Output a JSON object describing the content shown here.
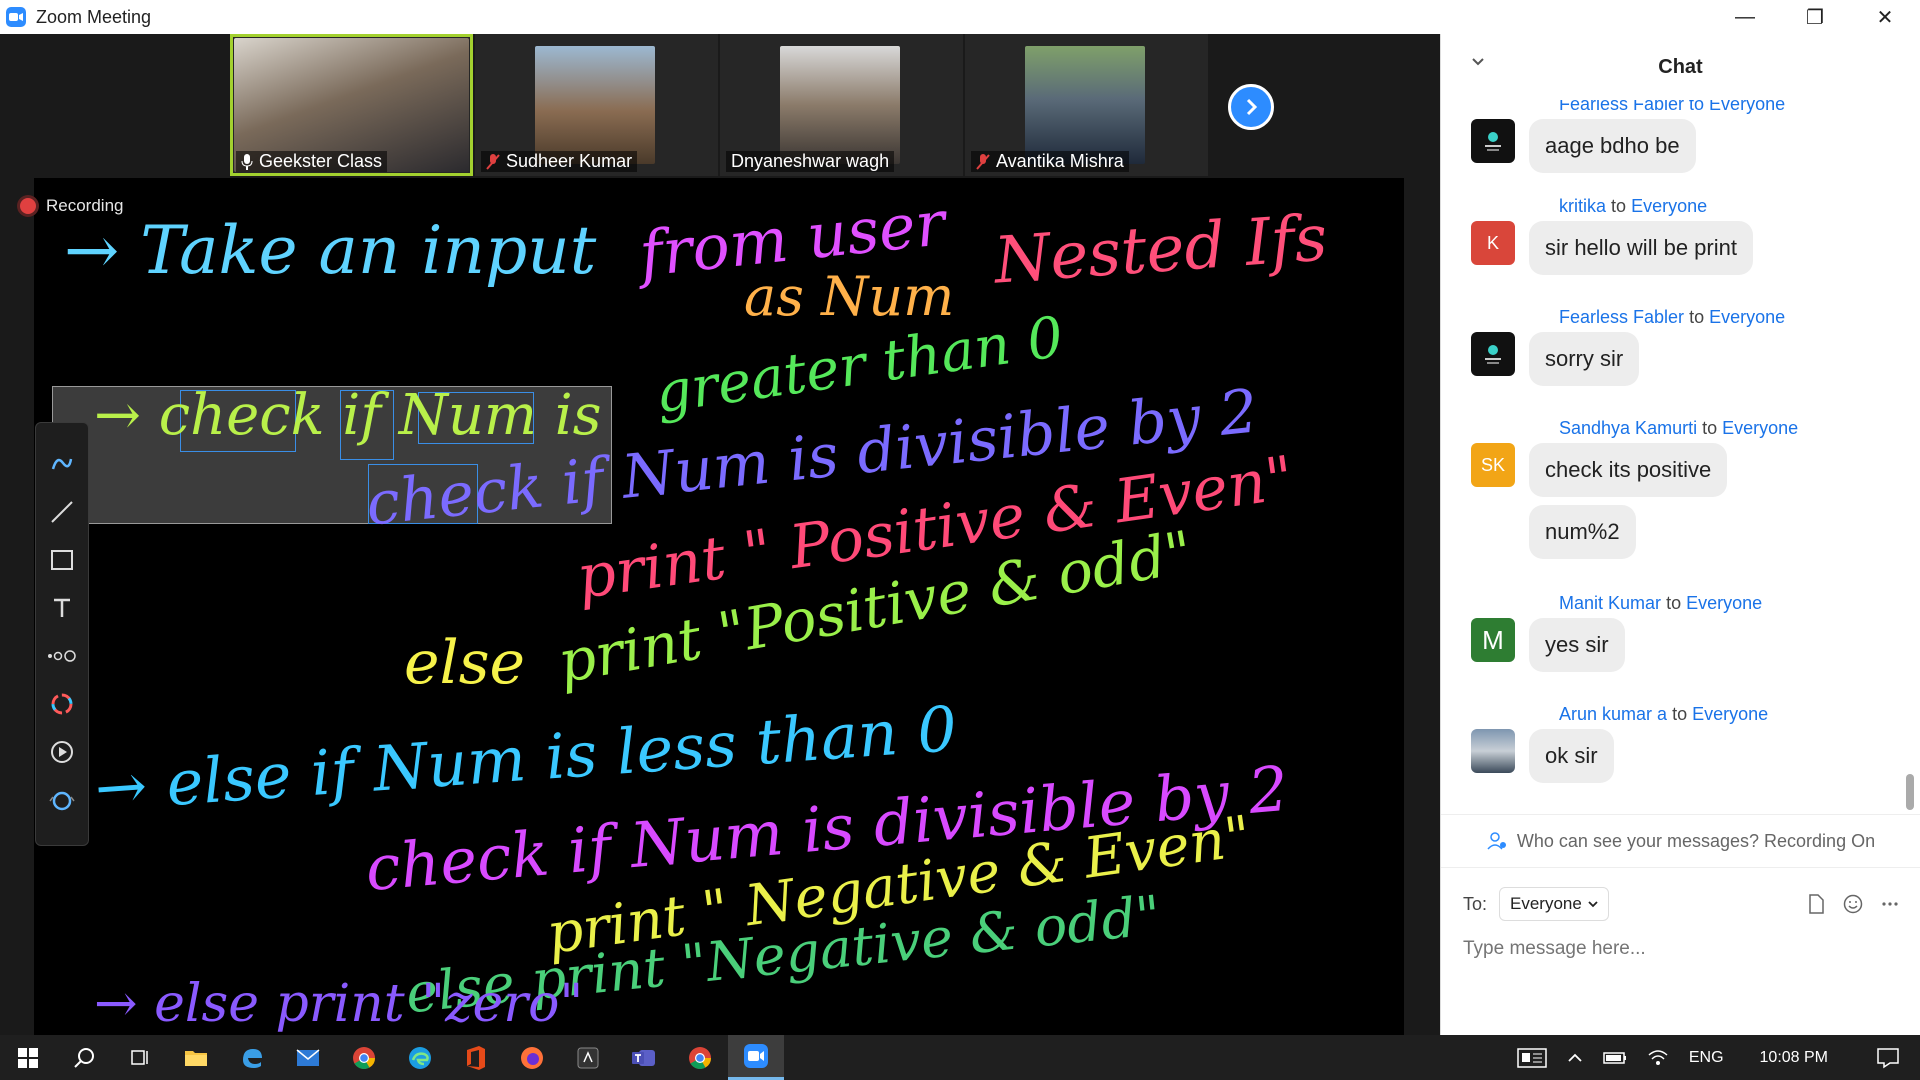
{
  "window": {
    "title": "Zoom Meeting"
  },
  "participants": [
    {
      "name": "Geekster Class",
      "muted": false,
      "active": true,
      "photo_color": "#6a5a4c"
    },
    {
      "name": "Sudheer Kumar",
      "muted": true,
      "active": false,
      "photo_color": "#7b6a55"
    },
    {
      "name": "Dnyaneshwar wagh",
      "muted": false,
      "active": false,
      "photo_color": "#8c8c8c"
    },
    {
      "name": "Avantika Mishra",
      "muted": true,
      "active": false,
      "photo_color": "#4e6e7a"
    }
  ],
  "recording": {
    "label": "Recording"
  },
  "whiteboard": {
    "lines": [
      {
        "text": "→ Take an input",
        "color": "#5fd3ff"
      },
      {
        "text": "from user",
        "color": "#e050ff"
      },
      {
        "text": "as Num",
        "color": "#ffb14a"
      },
      {
        "text": "Nested Ifs",
        "color": "#ff4f7a"
      },
      {
        "text": "→ check if Num is",
        "color": "#b9f04a"
      },
      {
        "text": "greater than 0",
        "color": "#55e85a"
      },
      {
        "text": "check if Num is divisible by 2",
        "color": "#7b6bff"
      },
      {
        "text": "print \" Positive & Even\"",
        "color": "#ff4a78"
      },
      {
        "text": "else",
        "color": "#f6f24a"
      },
      {
        "text": "print \"Positive & odd\"",
        "color": "#9af04a"
      },
      {
        "text": "→ else if Num is less than 0",
        "color": "#3ac8ff"
      },
      {
        "text": "check if Num is divisible by 2",
        "color": "#d84aff"
      },
      {
        "text": "print \" Negative & Even\"",
        "color": "#eaf04a"
      },
      {
        "text": "else print \"Negative & odd\"",
        "color": "#4acf7a"
      },
      {
        "text": "→ else print \"zero\"",
        "color": "#8a5aff"
      }
    ]
  },
  "chat": {
    "title": "Chat",
    "partial_header": "Fearless Fabler to Everyone",
    "messages": [
      {
        "from": "",
        "to": "",
        "avatar_text": "",
        "avatar_color": "#111111",
        "texts": [
          "aage bdho be"
        ]
      },
      {
        "from": "kritika",
        "to": "Everyone",
        "avatar_text": "K",
        "avatar_color": "#d9463a",
        "texts": [
          "sir hello will be print"
        ]
      },
      {
        "from": "Fearless Fabler",
        "to": "Everyone",
        "avatar_text": "",
        "avatar_color": "#111111",
        "texts": [
          "sorry sir"
        ]
      },
      {
        "from": "Sandhya Kamurti",
        "to": "Everyone",
        "avatar_text": "SK",
        "avatar_color": "#f2a516",
        "texts": [
          "check its positive",
          "num%2"
        ]
      },
      {
        "from": "Manit Kumar",
        "to": "Everyone",
        "avatar_text": "M",
        "avatar_color": "#2e7d32",
        "texts": [
          "yes sir"
        ]
      },
      {
        "from": "Arun kumar a",
        "to": "Everyone",
        "avatar_text": "",
        "avatar_color": "#6f8aa6",
        "texts": [
          "ok sir"
        ]
      }
    ],
    "to_word": "to",
    "visibility_note": "Who can see your messages? Recording On",
    "to_label": "To:",
    "recipient": "Everyone",
    "input_placeholder": "Type message here..."
  },
  "taskbar": {
    "language": "ENG",
    "time": "10:08 PM"
  }
}
